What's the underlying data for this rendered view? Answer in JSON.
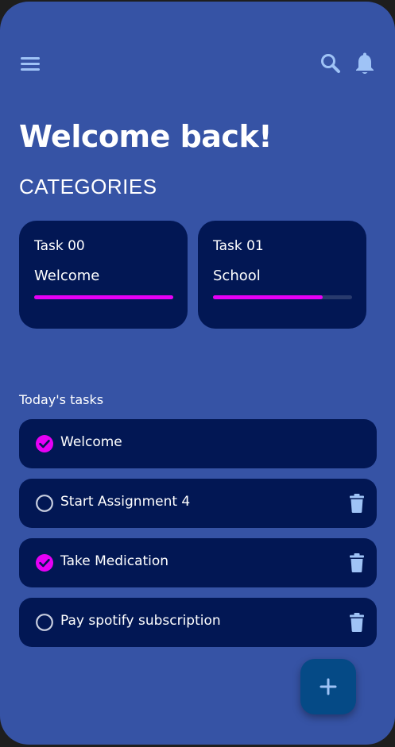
{
  "header": {
    "menu_icon": "menu-icon",
    "search_icon": "search-icon",
    "bell_icon": "bell-icon"
  },
  "title": "Welcome back!",
  "categories_heading": "CATEGORIES",
  "categories": [
    {
      "count": "Task 00",
      "name": "Welcome",
      "progress": 1.0
    },
    {
      "count": "Task 01",
      "name": "School",
      "progress": 0.79
    }
  ],
  "today_heading": "Today's tasks",
  "tasks": [
    {
      "label": "Welcome",
      "done": true,
      "deletable": false
    },
    {
      "label": "Start Assignment 4",
      "done": false,
      "deletable": true
    },
    {
      "label": "Take Medication",
      "done": true,
      "deletable": true
    },
    {
      "label": "Pay spotify subscription",
      "done": false,
      "deletable": true
    }
  ],
  "fab_icon": "plus-icon",
  "colors": {
    "background": "#3653a5",
    "card": "#021754",
    "accent": "#e600f5",
    "icon": "#9fc3f6",
    "fab": "#054a86"
  }
}
